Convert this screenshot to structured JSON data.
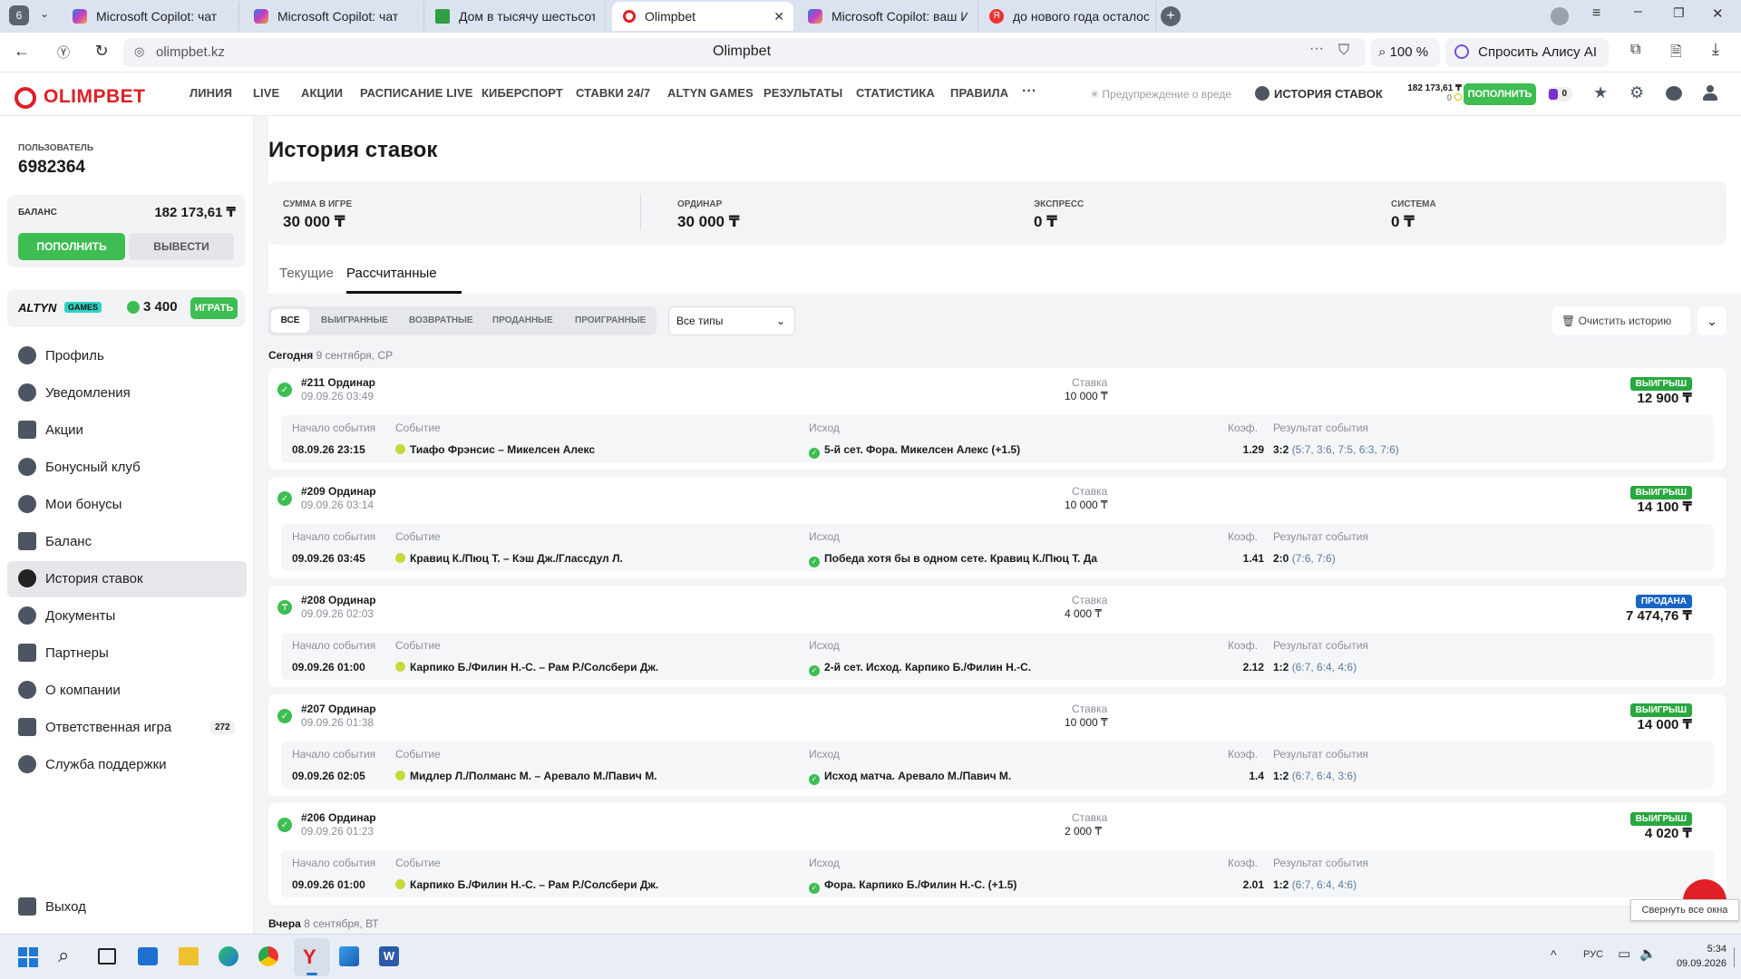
{
  "browser": {
    "tab_count": "6",
    "tabs": [
      {
        "title": "Microsoft Copilot: чат"
      },
      {
        "title": "Microsoft Copilot: чат"
      },
      {
        "title": "Дом в тысячу шестьсот э"
      },
      {
        "title": "Olimpbet"
      },
      {
        "title": "Microsoft Copilot: ваш ИИ"
      },
      {
        "title": "до нового года осталось"
      }
    ],
    "url": "olimpbet.kz",
    "page_title": "Olimpbet",
    "zoom": "100 %",
    "alice": "Спросить Алису AI"
  },
  "header": {
    "logo": "OLIMPBET",
    "nav": [
      "ЛИНИЯ",
      "LIVE",
      "АКЦИИ",
      "РАСПИСАНИЕ LIVE",
      "КИБЕРСПОРТ",
      "СТАВКИ 24/7",
      "ALTYN GAMES",
      "РЕЗУЛЬТАТЫ",
      "СТАТИСТИКА",
      "ПРАВИЛА"
    ],
    "more": "···",
    "warning": "Предупреждение о вреде",
    "history": "ИСТОРИЯ СТАВОК",
    "balance": "182 173,61 ₸",
    "bonus": "0",
    "deposit": "ПОПОЛНИТЬ",
    "chips": "0"
  },
  "sidebar": {
    "user_label": "ПОЛЬЗОВАТЕЛЬ",
    "user_id": "6982364",
    "balance_label": "БАЛАНС",
    "balance": "182 173,61 ₸",
    "deposit": "ПОПОЛНИТЬ",
    "withdraw": "ВЫВЕСТИ",
    "altyn_logo": "ALTYN",
    "altyn_games": "GAMES",
    "altyn_points": "3 400",
    "play": "ИГРАТЬ",
    "menu": [
      {
        "label": "Профиль"
      },
      {
        "label": "Уведомления"
      },
      {
        "label": "Акции"
      },
      {
        "label": "Бонусный клуб"
      },
      {
        "label": "Мои бонусы"
      },
      {
        "label": "Баланс"
      },
      {
        "label": "История ставок"
      },
      {
        "label": "Документы"
      },
      {
        "label": "Партнеры"
      },
      {
        "label": "О компании"
      },
      {
        "label": "Ответственная игра",
        "badge": "272"
      },
      {
        "label": "Служба поддержки"
      }
    ],
    "logout": "Выход"
  },
  "main": {
    "title": "История ставок",
    "summary": [
      {
        "label": "СУММА В ИГРЕ",
        "value": "30 000 ₸"
      },
      {
        "label": "ОРДИНАР",
        "value": "30 000 ₸"
      },
      {
        "label": "ЭКСПРЕСС",
        "value": "0 ₸"
      },
      {
        "label": "СИСТЕМА",
        "value": "0 ₸"
      }
    ],
    "tabs": [
      "Текущие",
      "Рассчитанные"
    ],
    "filters": [
      "ВСЕ",
      "ВЫИГРАННЫЕ",
      "ВОЗВРАТНЫЕ",
      "ПРОДАННЫЕ",
      "ПРОИГРАННЫЕ"
    ],
    "type_select": "Все типы",
    "clear": "Очистить историю",
    "day_today": "Сегодня",
    "day_today_date": "9 сентября, СР",
    "day_yesterday": "Вчера",
    "day_yesterday_date": "8 сентября, ВТ",
    "col_labels": {
      "stake": "Ставка",
      "start": "Начало события",
      "event": "Событие",
      "outcome": "Исход",
      "coef": "Коэф.",
      "result": "Результат события"
    },
    "bets": [
      {
        "id": "#211 Ординар",
        "time": "09.09.26 03:49",
        "stake": "10 000 ₸",
        "status": "ВЫИГРЫШ",
        "payout": "12 900 ₸",
        "start": "08.09.26 23:15",
        "event": "Тиафо Фрэнсис – Микелсен Алекс",
        "outcome": "5-й сет. Фора. Микелсен Алекс (+1.5)",
        "coef": "1.29",
        "score": "3:2",
        "sets": "(5:7, 3:6, 7:5, 6:3, 7:6)"
      },
      {
        "id": "#209 Ординар",
        "time": "09.09.26 03:14",
        "stake": "10 000 ₸",
        "status": "ВЫИГРЫШ",
        "payout": "14 100 ₸",
        "start": "09.09.26 03:45",
        "event": "Кравиц К./Пюц Т. – Кэш Дж./Глассдул Л.",
        "outcome": "Победа хотя бы в одном сете. Кравиц К./Пюц Т. Да",
        "coef": "1.41",
        "score": "2:0",
        "sets": "(7:6, 7:6)"
      },
      {
        "id": "#208 Ординар",
        "time": "09.09.26 02:03",
        "stake": "4 000 ₸",
        "status": "ПРОДАНА",
        "payout": "7 474,76 ₸",
        "start": "09.09.26 01:00",
        "event": "Карпико Б./Филин Н.-С. – Рам Р./Солсбери Дж.",
        "outcome": "2-й сет. Исход. Карпико Б./Филин Н.-С.",
        "coef": "2.12",
        "score": "1:2",
        "sets": "(6:7, 6:4, 4:6)"
      },
      {
        "id": "#207 Ординар",
        "time": "09.09.26 01:38",
        "stake": "10 000 ₸",
        "status": "ВЫИГРЫШ",
        "payout": "14 000 ₸",
        "start": "09.09.26 02:05",
        "event": "Мидлер Л./Полманс М. – Аревало М./Павич М.",
        "outcome": "Исход матча. Аревало М./Павич М.",
        "coef": "1.4",
        "score": "1:2",
        "sets": "(6:7, 6:4, 3:6)"
      },
      {
        "id": "#206 Ординар",
        "time": "09.09.26 01:23",
        "stake": "2 000 ₸",
        "status": "ВЫИГРЫШ",
        "payout": "4 020 ₸",
        "start": "09.09.26 01:00",
        "event": "Карпико Б./Филин Н.-С. – Рам Р./Солсбери Дж.",
        "outcome": "Фора. Карпико Б./Филин Н.-С. (+1.5)",
        "coef": "2.01",
        "score": "1:2",
        "sets": "(6:7, 6:4, 4:6)"
      }
    ]
  },
  "tooltip": "Свернуть все окна",
  "taskbar": {
    "lang": "РУС",
    "time": "5:34",
    "date": "09.09.2026"
  },
  "colors": {
    "brand": "#e01f26",
    "green": "#3dbd52",
    "sold": "#1965c4"
  }
}
